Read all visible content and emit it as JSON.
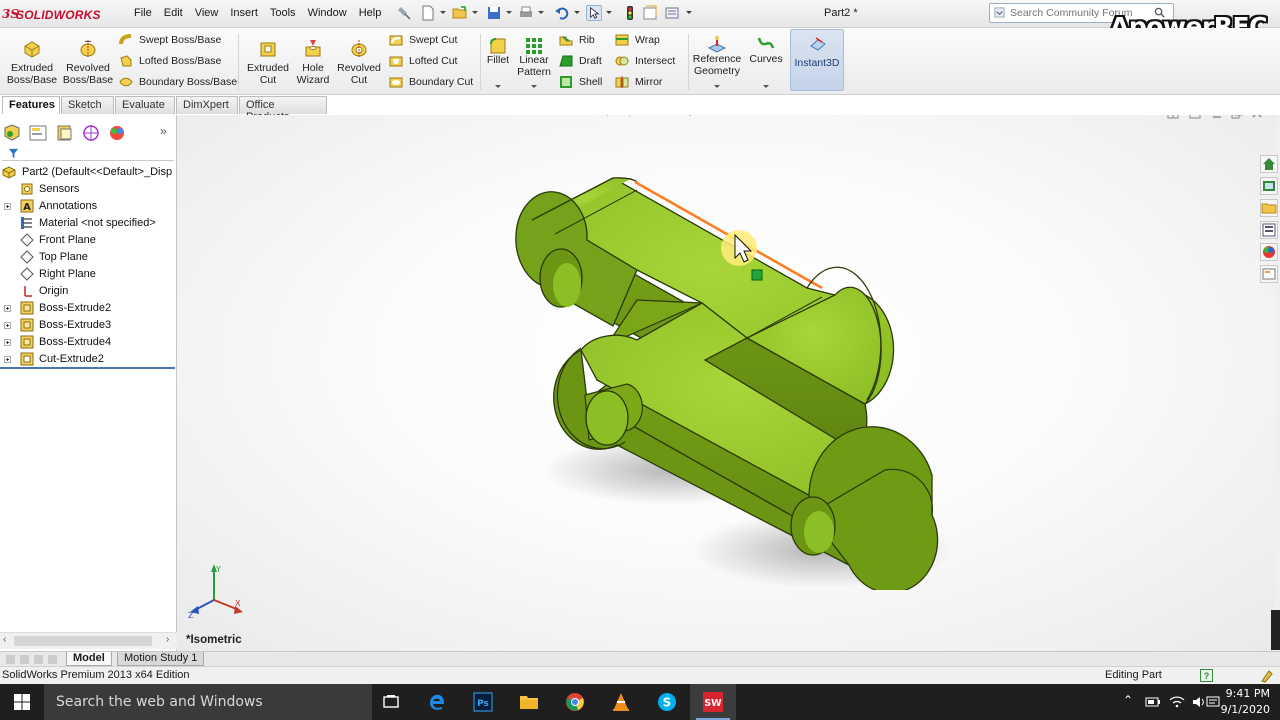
{
  "app": {
    "brand": "SOLIDWORKS",
    "document_title": "Part2 *",
    "menu": [
      "File",
      "Edit",
      "View",
      "Insert",
      "Tools",
      "Window",
      "Help"
    ],
    "search_placeholder": "Search Community Forum",
    "watermark": "ApowerREC"
  },
  "ribbon": {
    "big_buttons": [
      {
        "label": "Extruded\nBoss/Base",
        "icon": "extruded-boss-icon"
      },
      {
        "label": "Revolved\nBoss/Base",
        "icon": "revolved-boss-icon"
      },
      {
        "label": "Extruded\nCut",
        "icon": "extruded-cut-icon"
      },
      {
        "label": "Hole\nWizard",
        "icon": "hole-wizard-icon"
      },
      {
        "label": "Revolved\nCut",
        "icon": "revolved-cut-icon"
      },
      {
        "label": "Fillet",
        "icon": "fillet-icon"
      },
      {
        "label": "Linear\nPattern",
        "icon": "linear-pattern-icon"
      },
      {
        "label": "Reference\nGeometry",
        "icon": "reference-geometry-icon"
      },
      {
        "label": "Curves",
        "icon": "curves-icon"
      },
      {
        "label": "Instant3D",
        "icon": "instant3d-icon"
      }
    ],
    "boss_group": [
      "Swept Boss/Base",
      "Lofted Boss/Base",
      "Boundary Boss/Base"
    ],
    "cut_group": [
      "Swept Cut",
      "Lofted Cut",
      "Boundary Cut"
    ],
    "feature_group_a": [
      "Rib",
      "Draft",
      "Shell"
    ],
    "feature_group_b": [
      "Wrap",
      "Intersect",
      "Mirror"
    ]
  },
  "tabs": [
    "Features",
    "Sketch",
    "Evaluate",
    "DimXpert",
    "Office Products"
  ],
  "active_tab": "Features",
  "feature_tree": {
    "root": "Part2  (Default<<Default>_Disp",
    "items": [
      {
        "label": "Sensors",
        "icon": "sensors-icon",
        "expandable": false
      },
      {
        "label": "Annotations",
        "icon": "annotations-icon",
        "expandable": true
      },
      {
        "label": "Material <not specified>",
        "icon": "material-icon",
        "expandable": false
      },
      {
        "label": "Front Plane",
        "icon": "plane-icon",
        "expandable": false
      },
      {
        "label": "Top Plane",
        "icon": "plane-icon",
        "expandable": false
      },
      {
        "label": "Right Plane",
        "icon": "plane-icon",
        "expandable": false
      },
      {
        "label": "Origin",
        "icon": "origin-icon",
        "expandable": false
      },
      {
        "label": "Boss-Extrude2",
        "icon": "boss-extrude-icon",
        "expandable": true
      },
      {
        "label": "Boss-Extrude3",
        "icon": "boss-extrude-icon",
        "expandable": true
      },
      {
        "label": "Boss-Extrude4",
        "icon": "boss-extrude-icon",
        "expandable": true
      },
      {
        "label": "Cut-Extrude2",
        "icon": "cut-extrude-icon",
        "expandable": true
      }
    ]
  },
  "viewport": {
    "view_name": "*Isometric",
    "triad": {
      "x": "X",
      "y": "Y",
      "z": "Z"
    }
  },
  "bottom_tabs": [
    "Model",
    "Motion Study 1"
  ],
  "active_bottom_tab": "Model",
  "status": {
    "left": "SolidWorks Premium 2013 x64 Edition",
    "right": "Editing Part"
  },
  "taskbar": {
    "search_placeholder": "Search the web and Windows",
    "apps": [
      "task-view-icon",
      "edge-icon",
      "photoshop-icon",
      "file-explorer-icon",
      "chrome-icon",
      "vlc-icon",
      "skype-icon",
      "solidworks-icon"
    ],
    "time": "9:41 PM",
    "date": "9/1/2020"
  },
  "colors": {
    "part_top": "#9ccc2e",
    "part_side": "#6f9a14",
    "highlight_edge": "#ff7a1a",
    "accent_red": "#c8102e"
  }
}
